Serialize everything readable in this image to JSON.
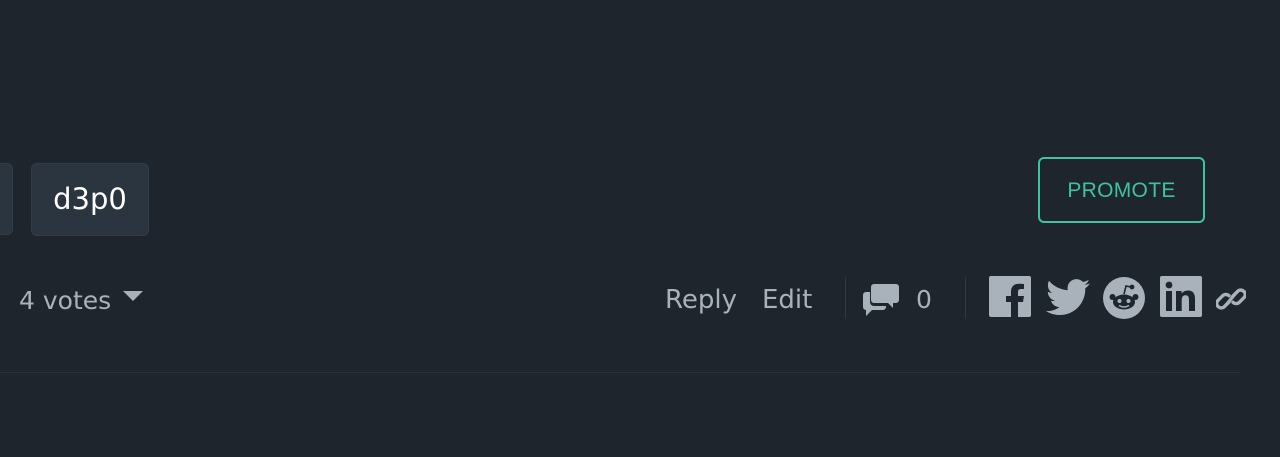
{
  "tags": {
    "visible_tag": "d3p0"
  },
  "promote": {
    "label": "PROMOTE"
  },
  "votes": {
    "label": "4 votes"
  },
  "actions": {
    "reply_label": "Reply",
    "edit_label": "Edit",
    "comments_count": "0"
  },
  "share": {
    "icons": [
      "facebook-icon",
      "twitter-icon",
      "reddit-icon",
      "linkedin-icon",
      "link-icon"
    ]
  },
  "colors": {
    "background": "#1e252d",
    "tag_background": "#2b3540",
    "accent": "#3fc2a0",
    "muted_text": "#a9b1ba"
  }
}
